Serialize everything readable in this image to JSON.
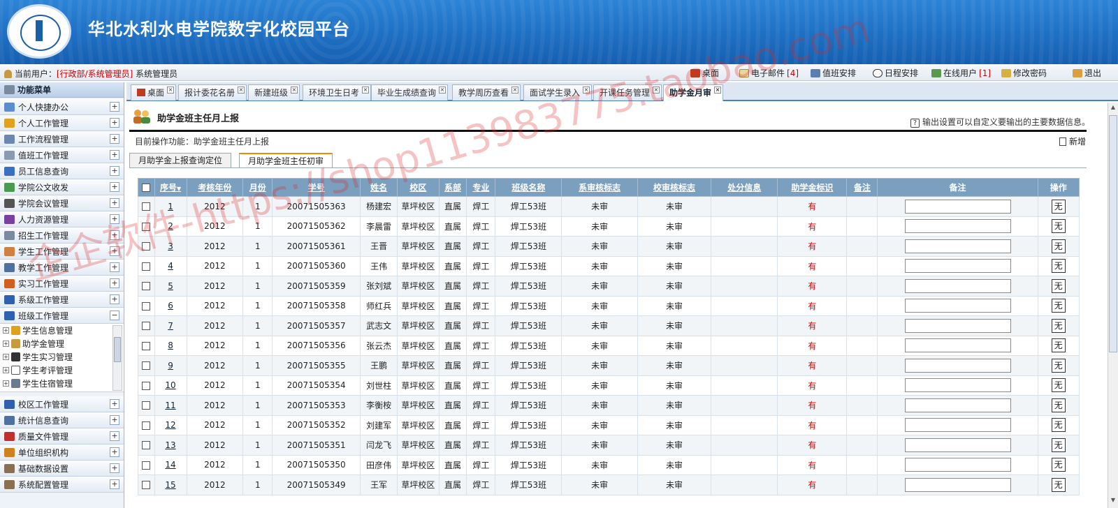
{
  "header": {
    "title": "华北水利水电学院数字化校园平台"
  },
  "userbar": {
    "label": "当前用户：",
    "role": "[行政部/系统管理员]",
    "name": "系统管理员",
    "nav": [
      {
        "label": "桌面",
        "icon": "home-icon",
        "count": ""
      },
      {
        "label": "电子邮件",
        "icon": "mail-icon",
        "count": "[4]"
      },
      {
        "label": "值班安排",
        "icon": "duty-icon",
        "count": ""
      },
      {
        "label": "日程安排",
        "icon": "clock-icon",
        "count": ""
      },
      {
        "label": "在线用户",
        "icon": "users-icon",
        "count": "[1]"
      },
      {
        "label": "修改密码",
        "icon": "key-icon",
        "count": ""
      },
      {
        "label": "退出",
        "icon": "logout-icon",
        "count": ""
      }
    ]
  },
  "sidebar": {
    "title": "功能菜单",
    "items": [
      {
        "label": "个人快捷办公",
        "color": "#5b8ed0"
      },
      {
        "label": "个人工作管理",
        "color": "#e0a020"
      },
      {
        "label": "工作流程管理",
        "color": "#6a88b0"
      },
      {
        "label": "值班工作管理",
        "color": "#8a9ab0"
      },
      {
        "label": "员工信息查询",
        "color": "#3a70c0"
      },
      {
        "label": "学院公文收发",
        "color": "#4a9a50"
      },
      {
        "label": "学院会议管理",
        "color": "#555555"
      },
      {
        "label": "人力资源管理",
        "color": "#7a3fa0"
      },
      {
        "label": "招生工作管理",
        "color": "#7a8aa0"
      },
      {
        "label": "学生工作管理",
        "color": "#d08040"
      },
      {
        "label": "教学工作管理",
        "color": "#5070a0"
      },
      {
        "label": "实习工作管理",
        "color": "#d06020"
      },
      {
        "label": "系级工作管理",
        "color": "#3060b0"
      },
      {
        "label": "班级工作管理",
        "color": "#3060b0"
      }
    ],
    "subitems": [
      "学生信息管理",
      "助学金管理",
      "学生实习管理",
      "学生考评管理",
      "学生住宿管理"
    ],
    "items_bottom": [
      {
        "label": "校区工作管理",
        "color": "#3060b0"
      },
      {
        "label": "统计信息查询",
        "color": "#5070a0"
      },
      {
        "label": "质量文件管理",
        "color": "#c03030"
      },
      {
        "label": "单位组织机构",
        "color": "#d08020"
      },
      {
        "label": "基础数据设置",
        "color": "#8a7050"
      },
      {
        "label": "系统配置管理",
        "color": "#8a7050"
      }
    ]
  },
  "tabs": [
    "桌面",
    "报计委花名册",
    "新建班级",
    "环境卫生日考",
    "毕业生成绩查询",
    "教学周历查看",
    "面试学生录入",
    "开课任务管理",
    "助学金月审"
  ],
  "page": {
    "title": "助学金班主任月上报",
    "help": "输出设置可以自定义要输出的主要数据信息。",
    "current_op": "目前操作功能：助学金班主任月上报",
    "new_label": "新增",
    "subtabs": [
      "月助学金上报查询定位",
      "月助学金班主任初审"
    ]
  },
  "table": {
    "columns": [
      "序号",
      "考核年份",
      "月份",
      "学号",
      "姓名",
      "校区",
      "系部",
      "专业",
      "班级名称",
      "系审核标志",
      "校审核标志",
      "处分信息",
      "助学金标识",
      "备注",
      "备注",
      "操作"
    ],
    "rows": [
      {
        "seq": "1",
        "year": "2012",
        "month": "1",
        "sid": "20071505363",
        "name": "杨建宏",
        "campus": "草坪校区",
        "dept": "直属",
        "major": "焊工",
        "class": "焊工53班",
        "dept_audit": "未审",
        "school_audit": "未审",
        "punish": "",
        "flag": "有",
        "note": "",
        "op": "无"
      },
      {
        "seq": "2",
        "year": "2012",
        "month": "1",
        "sid": "20071505362",
        "name": "李晨雷",
        "campus": "草坪校区",
        "dept": "直属",
        "major": "焊工",
        "class": "焊工53班",
        "dept_audit": "未审",
        "school_audit": "未审",
        "punish": "",
        "flag": "有",
        "note": "",
        "op": "无"
      },
      {
        "seq": "3",
        "year": "2012",
        "month": "1",
        "sid": "20071505361",
        "name": "王晋",
        "campus": "草坪校区",
        "dept": "直属",
        "major": "焊工",
        "class": "焊工53班",
        "dept_audit": "未审",
        "school_audit": "未审",
        "punish": "",
        "flag": "有",
        "note": "",
        "op": "无"
      },
      {
        "seq": "4",
        "year": "2012",
        "month": "1",
        "sid": "20071505360",
        "name": "王伟",
        "campus": "草坪校区",
        "dept": "直属",
        "major": "焊工",
        "class": "焊工53班",
        "dept_audit": "未审",
        "school_audit": "未审",
        "punish": "",
        "flag": "有",
        "note": "",
        "op": "无"
      },
      {
        "seq": "5",
        "year": "2012",
        "month": "1",
        "sid": "20071505359",
        "name": "张刘斌",
        "campus": "草坪校区",
        "dept": "直属",
        "major": "焊工",
        "class": "焊工53班",
        "dept_audit": "未审",
        "school_audit": "未审",
        "punish": "",
        "flag": "有",
        "note": "",
        "op": "无"
      },
      {
        "seq": "6",
        "year": "2012",
        "month": "1",
        "sid": "20071505358",
        "name": "师红兵",
        "campus": "草坪校区",
        "dept": "直属",
        "major": "焊工",
        "class": "焊工53班",
        "dept_audit": "未审",
        "school_audit": "未审",
        "punish": "",
        "flag": "有",
        "note": "",
        "op": "无"
      },
      {
        "seq": "7",
        "year": "2012",
        "month": "1",
        "sid": "20071505357",
        "name": "武志文",
        "campus": "草坪校区",
        "dept": "直属",
        "major": "焊工",
        "class": "焊工53班",
        "dept_audit": "未审",
        "school_audit": "未审",
        "punish": "",
        "flag": "有",
        "note": "",
        "op": "无"
      },
      {
        "seq": "8",
        "year": "2012",
        "month": "1",
        "sid": "20071505356",
        "name": "张云杰",
        "campus": "草坪校区",
        "dept": "直属",
        "major": "焊工",
        "class": "焊工53班",
        "dept_audit": "未审",
        "school_audit": "未审",
        "punish": "",
        "flag": "有",
        "note": "",
        "op": "无"
      },
      {
        "seq": "9",
        "year": "2012",
        "month": "1",
        "sid": "20071505355",
        "name": "王鹏",
        "campus": "草坪校区",
        "dept": "直属",
        "major": "焊工",
        "class": "焊工53班",
        "dept_audit": "未审",
        "school_audit": "未审",
        "punish": "",
        "flag": "有",
        "note": "",
        "op": "无"
      },
      {
        "seq": "10",
        "year": "2012",
        "month": "1",
        "sid": "20071505354",
        "name": "刘世柱",
        "campus": "草坪校区",
        "dept": "直属",
        "major": "焊工",
        "class": "焊工53班",
        "dept_audit": "未审",
        "school_audit": "未审",
        "punish": "",
        "flag": "有",
        "note": "",
        "op": "无"
      },
      {
        "seq": "11",
        "year": "2012",
        "month": "1",
        "sid": "20071505353",
        "name": "李衡桉",
        "campus": "草坪校区",
        "dept": "直属",
        "major": "焊工",
        "class": "焊工53班",
        "dept_audit": "未审",
        "school_audit": "未审",
        "punish": "",
        "flag": "有",
        "note": "",
        "op": "无"
      },
      {
        "seq": "12",
        "year": "2012",
        "month": "1",
        "sid": "20071505352",
        "name": "刘建军",
        "campus": "草坪校区",
        "dept": "直属",
        "major": "焊工",
        "class": "焊工53班",
        "dept_audit": "未审",
        "school_audit": "未审",
        "punish": "",
        "flag": "有",
        "note": "",
        "op": "无"
      },
      {
        "seq": "13",
        "year": "2012",
        "month": "1",
        "sid": "20071505351",
        "name": "闫龙飞",
        "campus": "草坪校区",
        "dept": "直属",
        "major": "焊工",
        "class": "焊工53班",
        "dept_audit": "未审",
        "school_audit": "未审",
        "punish": "",
        "flag": "有",
        "note": "",
        "op": "无"
      },
      {
        "seq": "14",
        "year": "2012",
        "month": "1",
        "sid": "20071505350",
        "name": "田彦伟",
        "campus": "草坪校区",
        "dept": "直属",
        "major": "焊工",
        "class": "焊工53班",
        "dept_audit": "未审",
        "school_audit": "未审",
        "punish": "",
        "flag": "有",
        "note": "",
        "op": "无"
      },
      {
        "seq": "15",
        "year": "2012",
        "month": "1",
        "sid": "20071505349",
        "name": "王军",
        "campus": "草坪校区",
        "dept": "直属",
        "major": "焊工",
        "class": "焊工53班",
        "dept_audit": "未审",
        "school_audit": "未审",
        "punish": "",
        "flag": "有",
        "note": "",
        "op": "无"
      }
    ]
  },
  "watermark": "企企软件-https://shop113983775.taobao.com"
}
